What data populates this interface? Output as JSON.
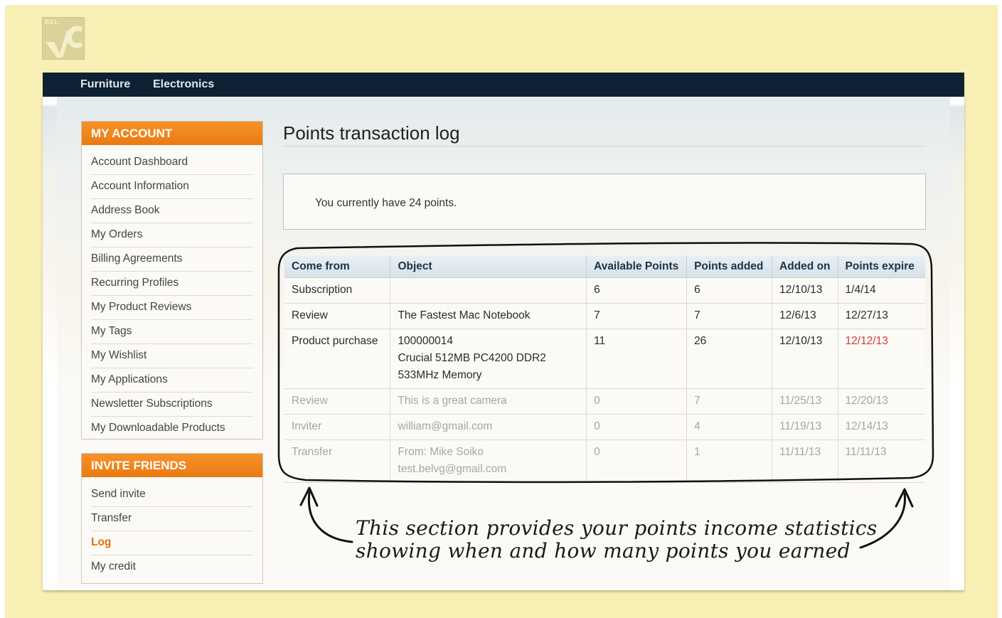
{
  "logo": {
    "text": "BEL"
  },
  "topnav": {
    "items": [
      "Furniture",
      "Electronics"
    ]
  },
  "my_account": {
    "title": "MY ACCOUNT",
    "items": [
      "Account Dashboard",
      "Account Information",
      "Address Book",
      "My Orders",
      "Billing Agreements",
      "Recurring Profiles",
      "My Product Reviews",
      "My Tags",
      "My Wishlist",
      "My Applications",
      "Newsletter Subscriptions",
      "My Downloadable Products"
    ]
  },
  "invite_friends": {
    "title": "INVITE FRIENDS",
    "items": [
      "Send invite",
      "Transfer",
      "Log",
      "My credit"
    ],
    "active": "Log"
  },
  "main": {
    "title": "Points transaction log",
    "points_message": "You currently have 24 points."
  },
  "table": {
    "headers": [
      "Come from",
      "Object",
      "Available Points",
      "Points added",
      "Added on",
      "Points expire"
    ],
    "rows": [
      {
        "come_from": "Subscription",
        "object": "",
        "available": "6",
        "added": "6",
        "added_on": "12/10/13",
        "expire": "1/4/14"
      },
      {
        "come_from": "Review",
        "object": "The Fastest Mac Notebook",
        "available": "7",
        "added": "7",
        "added_on": "12/6/13",
        "expire": "12/27/13"
      },
      {
        "come_from": "Product purchase",
        "object_lines": [
          "100000014",
          "Crucial 512MB PC4200 DDR2",
          "533MHz Memory"
        ],
        "available": "11",
        "added": "26",
        "added_on": "12/10/13",
        "expire": "12/12/13"
      },
      {
        "come_from": "Review",
        "object": "This is a great camera",
        "available": "0",
        "added": "7",
        "added_on": "11/25/13",
        "expire": "12/20/13"
      },
      {
        "come_from": "Inviter",
        "object": "william@gmail.com",
        "available": "0",
        "added": "4",
        "added_on": "11/19/13",
        "expire": "12/14/13"
      },
      {
        "come_from": "Transfer",
        "object_lines": [
          "From: Mike Soiko",
          "test.belvg@gmail.com"
        ],
        "available": "0",
        "added": "1",
        "added_on": "11/11/13",
        "expire": "11/11/13"
      }
    ]
  },
  "annotation": {
    "line1": "This section provides your points income statistics",
    "line2": "showing when and how many points you earned"
  },
  "colors": {
    "background": "#f8efb4",
    "nav": "#0f2233",
    "accent": "#ea7a12",
    "expired": "#d23b3b"
  }
}
